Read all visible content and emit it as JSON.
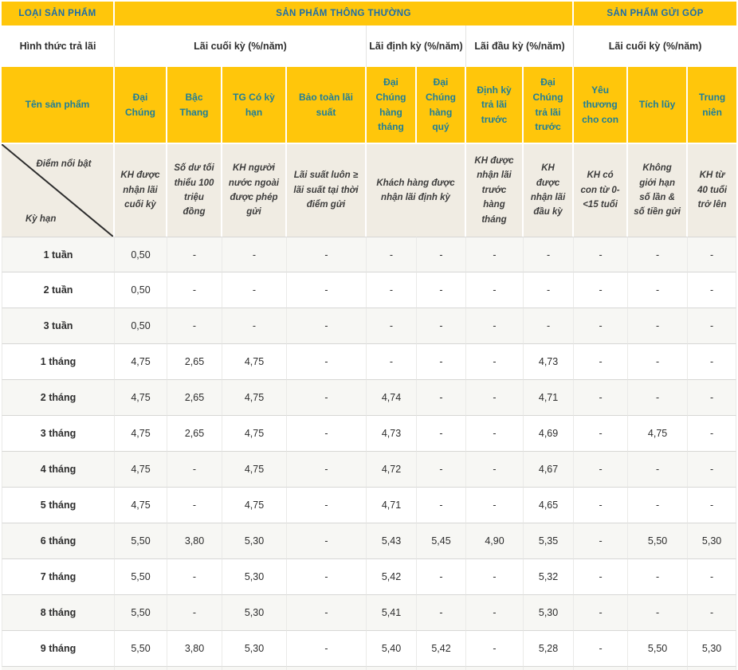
{
  "colors": {
    "header_yellow": "#FFC60B",
    "category_text_blue": "#1C6EA9",
    "product_text_teal": "#1E7E99",
    "highlight_beige": "#F0ECE3",
    "row_alt_gray": "#F7F7F4"
  },
  "table": {
    "header_row1": {
      "col1": "LOẠI SẢN PHẨM",
      "normal": "SẢN PHẨM THÔNG THƯỜNG",
      "gui_gop": "SẢN PHẨM GỬI GÓP"
    },
    "header_row2": {
      "col1": "Hình thức trả lãi",
      "cuoi_ky": "Lãi cuối kỳ (%/năm)",
      "dinh_ky": "Lãi định kỳ (%/năm)",
      "dau_ky": "Lãi đầu kỳ (%/năm)",
      "cuoi_ky_gop": "Lãi cuối kỳ (%/năm)"
    },
    "header_row3": {
      "col1": "Tên sản phẩm"
    },
    "products": [
      "Đại Chúng",
      "Bậc Thang",
      "TG Có kỳ hạn",
      "Bảo toàn lãi suất",
      "Đại Chúng hàng tháng",
      "Đại Chúng hàng quý",
      "Định kỳ trả lãi trước",
      "Đại Chúng trả lãi trước",
      "Yêu thương cho con",
      "Tích lũy",
      "Trung niên"
    ],
    "highlight_row": {
      "top_label": "Điểm nổi bật",
      "bottom_label": "Kỳ hạn",
      "notes": [
        "KH được nhận lãi cuối kỳ",
        "Số dư tối thiểu 100 triệu đồng",
        "KH người nước ngoài được phép gửi",
        "Lãi suất luôn ≥ lãi suất tại thời điểm gửi",
        "Khách hàng được nhận lãi định kỳ",
        "KH được nhận lãi trước hàng tháng",
        "KH được nhận lãi đầu kỳ",
        "KH có con từ 0-<15 tuổi",
        "Không giới hạn số lần & số tiền gửi",
        "KH từ 40 tuổi trở lên"
      ]
    },
    "rows": [
      {
        "term": "1 tuần",
        "values": [
          "0,50",
          "-",
          "-",
          "-",
          "-",
          "-",
          "-",
          "-",
          "-",
          "-",
          "-"
        ]
      },
      {
        "term": "2 tuần",
        "values": [
          "0,50",
          "-",
          "-",
          "-",
          "-",
          "-",
          "-",
          "-",
          "-",
          "-",
          "-"
        ]
      },
      {
        "term": "3 tuần",
        "values": [
          "0,50",
          "-",
          "-",
          "-",
          "-",
          "-",
          "-",
          "-",
          "-",
          "-",
          "-"
        ]
      },
      {
        "term": "1 tháng",
        "values": [
          "4,75",
          "2,65",
          "4,75",
          "-",
          "-",
          "-",
          "-",
          "4,73",
          "-",
          "-",
          "-"
        ]
      },
      {
        "term": "2 tháng",
        "values": [
          "4,75",
          "2,65",
          "4,75",
          "-",
          "4,74",
          "-",
          "-",
          "4,71",
          "-",
          "-",
          "-"
        ]
      },
      {
        "term": "3 tháng",
        "values": [
          "4,75",
          "2,65",
          "4,75",
          "-",
          "4,73",
          "-",
          "-",
          "4,69",
          "-",
          "4,75",
          "-"
        ]
      },
      {
        "term": "4 tháng",
        "values": [
          "4,75",
          "-",
          "4,75",
          "-",
          "4,72",
          "-",
          "-",
          "4,67",
          "-",
          "-",
          "-"
        ]
      },
      {
        "term": "5 tháng",
        "values": [
          "4,75",
          "-",
          "4,75",
          "-",
          "4,71",
          "-",
          "-",
          "4,65",
          "-",
          "-",
          "-"
        ]
      },
      {
        "term": "6 tháng",
        "values": [
          "5,50",
          "3,80",
          "5,30",
          "-",
          "5,43",
          "5,45",
          "4,90",
          "5,35",
          "-",
          "5,50",
          "5,30"
        ]
      },
      {
        "term": "7 tháng",
        "values": [
          "5,50",
          "-",
          "5,30",
          "-",
          "5,42",
          "-",
          "-",
          "5,32",
          "-",
          "-",
          "-"
        ]
      },
      {
        "term": "8 tháng",
        "values": [
          "5,50",
          "-",
          "5,30",
          "-",
          "5,41",
          "-",
          "-",
          "5,30",
          "-",
          "-",
          "-"
        ]
      },
      {
        "term": "9 tháng",
        "values": [
          "5,50",
          "3,80",
          "5,30",
          "-",
          "5,40",
          "5,42",
          "-",
          "5,28",
          "-",
          "5,50",
          "5,30"
        ]
      }
    ]
  }
}
